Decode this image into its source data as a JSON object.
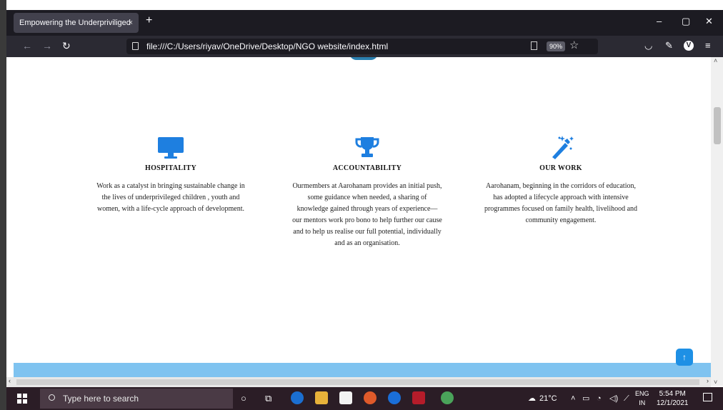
{
  "browser": {
    "tab_title": "Empowering the Underpriviliged",
    "tab_close": "×",
    "new_tab": "+",
    "url": "file:///C:/Users/riyav/OneDrive/Desktop/NGO website/index.html",
    "zoom": "90%",
    "window_controls": [
      "–",
      "▢",
      "✕"
    ]
  },
  "page": {
    "columns": [
      {
        "icon": "monitor-icon",
        "title": "HOSPITALITY",
        "text": "Work as a catalyst in bringing sustainable change in the lives of underprivileged children , youth and women, with a life-cycle approach of development."
      },
      {
        "icon": "trophy-icon",
        "title": "ACCOUNTABILITY",
        "text": "Ourmembers at Aarohanam provides an initial push, some guidance when needed, a sharing of knowledge gained through years of experience—our mentors work pro bono to help further our cause and to help us realise our full potential, individually and as an organisation."
      },
      {
        "icon": "magic-wand-icon",
        "title": "OUR  WORK",
        "text": "Aarohanam, beginning in the corridors of education, has adopted a lifecycle approach with intensive programmes focused on family health, livelihood and community engagement."
      }
    ],
    "accent_color": "#1e7fe0",
    "footer_color": "#7fc3f0"
  },
  "taskbar": {
    "search_placeholder": "Type here to search",
    "temperature": "21°C",
    "language_top": "ENG",
    "language_bottom": "IN",
    "time": "5:54 PM",
    "date": "12/1/2021"
  }
}
